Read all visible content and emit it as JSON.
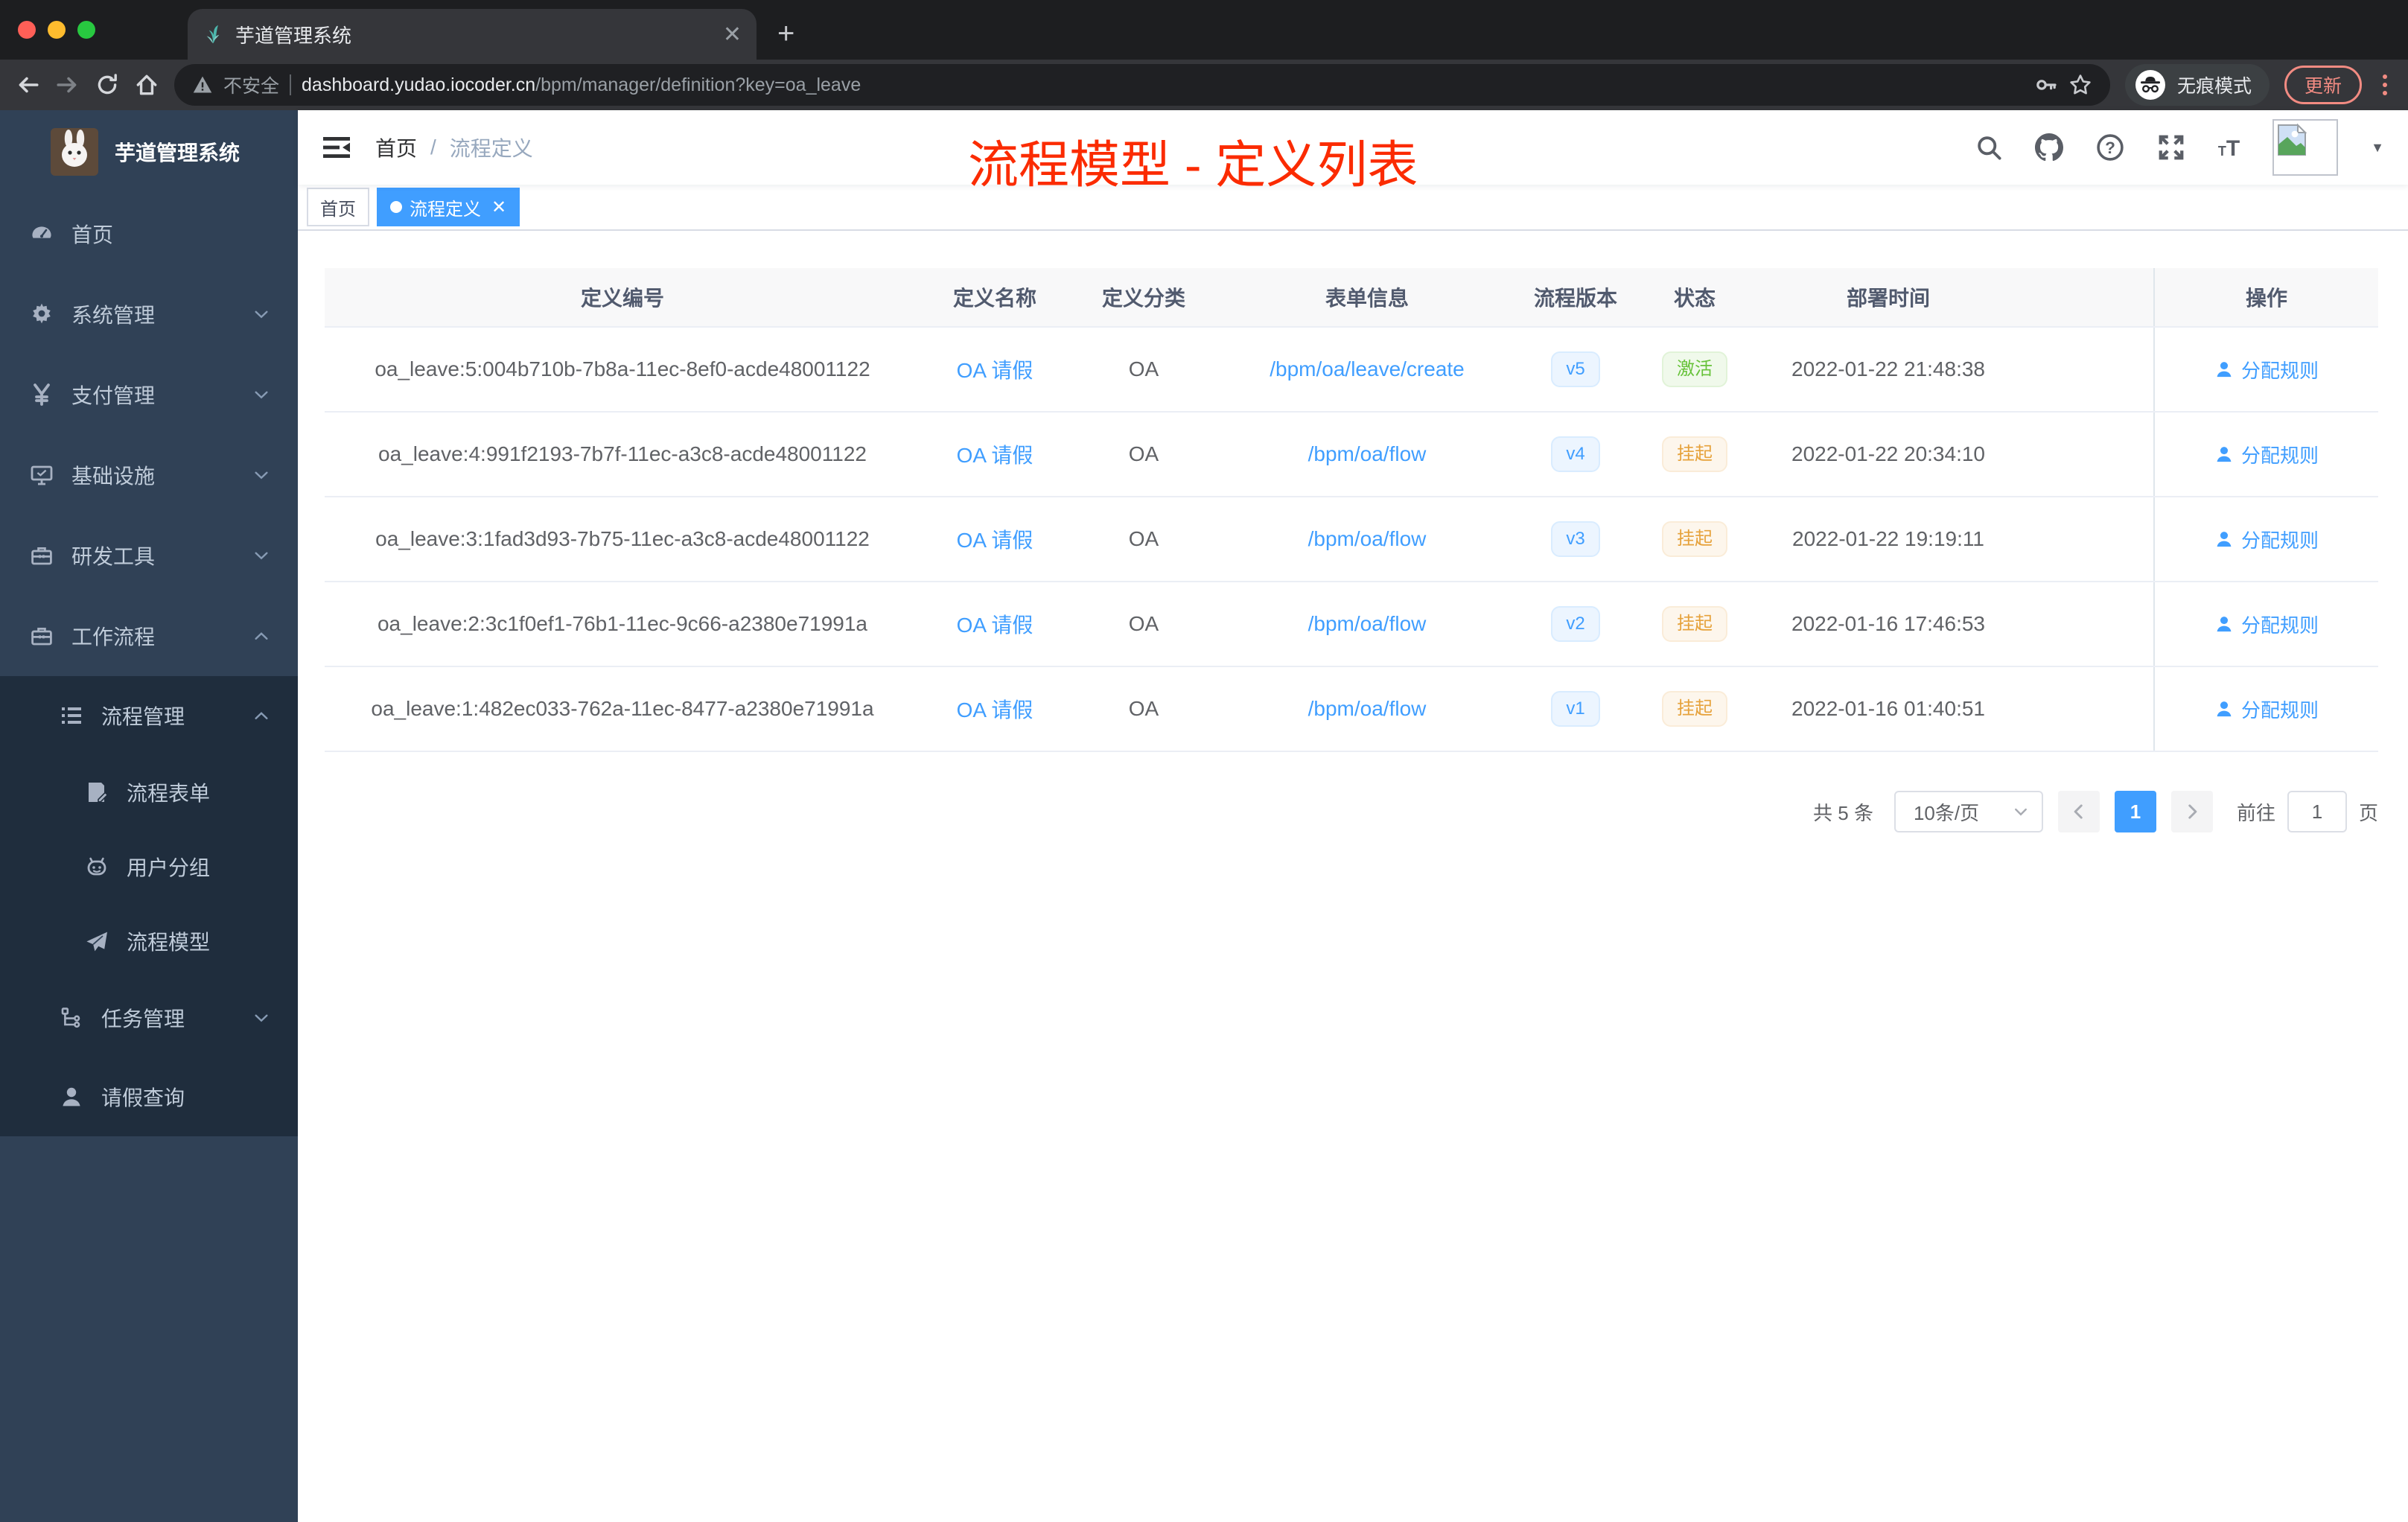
{
  "browser": {
    "tab_title": "芋道管理系统",
    "security_label": "不安全",
    "url_host": "dashboard.yudao.iocoder.cn",
    "url_path": "/bpm/manager/definition?key=oa_leave",
    "incognito_label": "无痕模式",
    "update_label": "更新"
  },
  "sidebar": {
    "logo_title": "芋道管理系统",
    "items": [
      {
        "key": "home",
        "icon": "dashboard-icon",
        "label": "首页",
        "level": 1
      },
      {
        "key": "system",
        "icon": "gear-icon",
        "label": "系统管理",
        "level": 1,
        "chevron": "down"
      },
      {
        "key": "payment",
        "icon": "yen-icon",
        "label": "支付管理",
        "level": 1,
        "chevron": "down"
      },
      {
        "key": "infra",
        "icon": "monitor-icon",
        "label": "基础设施",
        "level": 1,
        "chevron": "down"
      },
      {
        "key": "devtools",
        "icon": "toolbox-icon",
        "label": "研发工具",
        "level": 1,
        "chevron": "down"
      },
      {
        "key": "workflow",
        "icon": "toolbox-icon",
        "label": "工作流程",
        "level": 1,
        "chevron": "up"
      },
      {
        "key": "process-manage",
        "icon": "list-icon",
        "label": "流程管理",
        "level": 2,
        "chevron": "up",
        "in_submenu": true
      },
      {
        "key": "process-form",
        "icon": "form-icon",
        "label": "流程表单",
        "level": 3,
        "in_submenu": true
      },
      {
        "key": "user-group",
        "icon": "robot-icon",
        "label": "用户分组",
        "level": 3,
        "in_submenu": true
      },
      {
        "key": "process-model",
        "icon": "paper-plane-icon",
        "label": "流程模型",
        "level": 3,
        "in_submenu": true
      },
      {
        "key": "task-manage",
        "icon": "tree-icon",
        "label": "任务管理",
        "level": 2,
        "chevron": "down",
        "in_submenu": true
      },
      {
        "key": "leave-query",
        "icon": "user-icon",
        "label": "请假查询",
        "level": 2,
        "in_submenu": true
      }
    ]
  },
  "header": {
    "breadcrumb": [
      "首页",
      "流程定义"
    ],
    "overlay_title": "流程模型 - 定义列表"
  },
  "tags": [
    {
      "label": "首页",
      "active": false,
      "closable": false
    },
    {
      "label": "流程定义",
      "active": true,
      "closable": true
    }
  ],
  "table": {
    "columns": [
      "定义编号",
      "定义名称",
      "定义分类",
      "表单信息",
      "流程版本",
      "状态",
      "部署时间",
      "操作"
    ],
    "rows": [
      {
        "id": "oa_leave:5:004b710b-7b8a-11ec-8ef0-acde48001122",
        "name": "OA 请假",
        "category": "OA",
        "form": "/bpm/oa/leave/create",
        "version": "v5",
        "status": "激活",
        "status_type": "success",
        "deploy_time": "2022-01-22 21:48:38",
        "action": "分配规则"
      },
      {
        "id": "oa_leave:4:991f2193-7b7f-11ec-a3c8-acde48001122",
        "name": "OA 请假",
        "category": "OA",
        "form": "/bpm/oa/flow",
        "version": "v4",
        "status": "挂起",
        "status_type": "warning",
        "deploy_time": "2022-01-22 20:34:10",
        "action": "分配规则"
      },
      {
        "id": "oa_leave:3:1fad3d93-7b75-11ec-a3c8-acde48001122",
        "name": "OA 请假",
        "category": "OA",
        "form": "/bpm/oa/flow",
        "version": "v3",
        "status": "挂起",
        "status_type": "warning",
        "deploy_time": "2022-01-22 19:19:11",
        "action": "分配规则"
      },
      {
        "id": "oa_leave:2:3c1f0ef1-76b1-11ec-9c66-a2380e71991a",
        "name": "OA 请假",
        "category": "OA",
        "form": "/bpm/oa/flow",
        "version": "v2",
        "status": "挂起",
        "status_type": "warning",
        "deploy_time": "2022-01-16 17:46:53",
        "action": "分配规则"
      },
      {
        "id": "oa_leave:1:482ec033-762a-11ec-8477-a2380e71991a",
        "name": "OA 请假",
        "category": "OA",
        "form": "/bpm/oa/flow",
        "version": "v1",
        "status": "挂起",
        "status_type": "warning",
        "deploy_time": "2022-01-16 01:40:51",
        "action": "分配规则"
      }
    ]
  },
  "pagination": {
    "total_label": "共 5 条",
    "page_size": "10条/页",
    "current_page": "1",
    "goto_label": "前往",
    "goto_value": "1",
    "page_unit_label": "页"
  },
  "colors": {
    "accent": "#409eff",
    "success": "#67c23a",
    "warning": "#e6a23c",
    "overlay_title": "#fb2b00",
    "sidebar_bg": "#304156",
    "submenu_bg": "#1f2d3d"
  }
}
